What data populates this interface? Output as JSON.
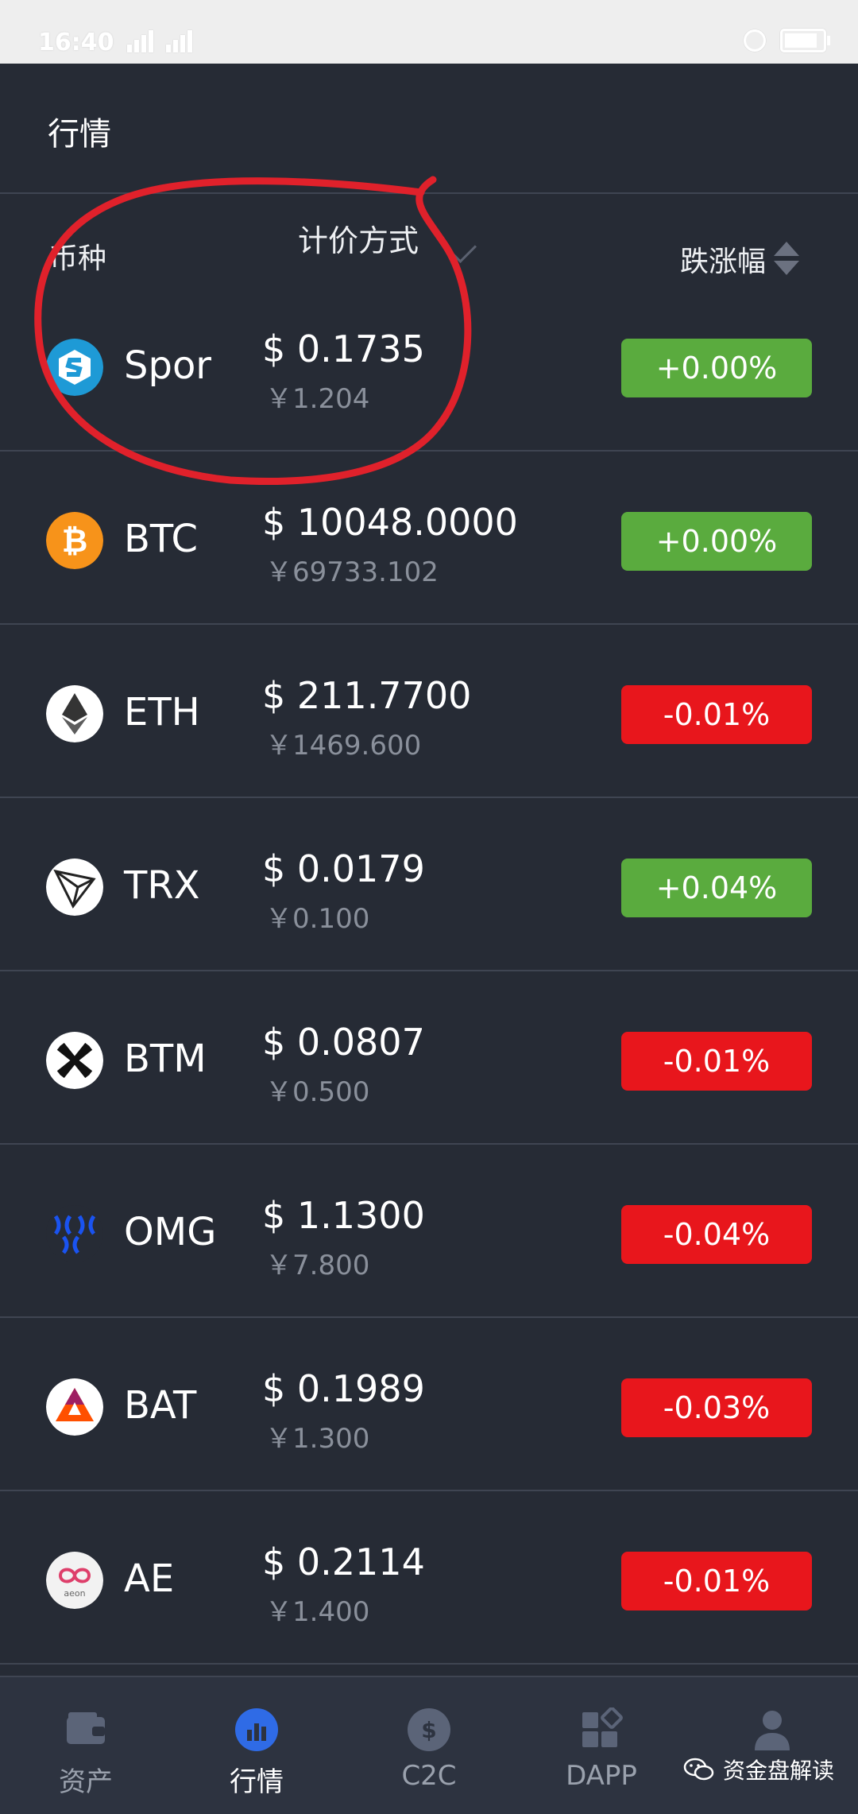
{
  "status_bar": {
    "time": "16:40"
  },
  "header": {
    "title": "行情"
  },
  "columns": {
    "coin": "币种",
    "pricing_method": "计价方式",
    "change": "跌涨幅"
  },
  "colors": {
    "up": "#5aab3e",
    "down": "#e8161c",
    "background": "#262b35",
    "annotation": "#e0212b"
  },
  "rows": [
    {
      "symbol": "Spor",
      "icon": "spor-icon",
      "price_usd": "$ 0.1735",
      "price_cny": "￥1.204",
      "change": "+0.00%",
      "trend": "up"
    },
    {
      "symbol": "BTC",
      "icon": "bitcoin-icon",
      "price_usd": "$ 10048.0000",
      "price_cny": "￥69733.102",
      "change": "+0.00%",
      "trend": "up"
    },
    {
      "symbol": "ETH",
      "icon": "ethereum-icon",
      "price_usd": "$ 211.7700",
      "price_cny": "￥1469.600",
      "change": "-0.01%",
      "trend": "down"
    },
    {
      "symbol": "TRX",
      "icon": "tron-icon",
      "price_usd": "$ 0.0179",
      "price_cny": "￥0.100",
      "change": "+0.04%",
      "trend": "up"
    },
    {
      "symbol": "BTM",
      "icon": "bytom-icon",
      "price_usd": "$ 0.0807",
      "price_cny": "￥0.500",
      "change": "-0.01%",
      "trend": "down"
    },
    {
      "symbol": "OMG",
      "icon": "omisego-icon",
      "price_usd": "$ 1.1300",
      "price_cny": "￥7.800",
      "change": "-0.04%",
      "trend": "down"
    },
    {
      "symbol": "BAT",
      "icon": "bat-icon",
      "price_usd": "$ 0.1989",
      "price_cny": "￥1.300",
      "change": "-0.03%",
      "trend": "down"
    },
    {
      "symbol": "AE",
      "icon": "aeternity-icon",
      "price_usd": "$ 0.2114",
      "price_cny": "￥1.400",
      "change": "-0.01%",
      "trend": "down"
    }
  ],
  "bottom_nav": [
    {
      "label": "资产",
      "icon": "wallet-icon",
      "active": false
    },
    {
      "label": "行情",
      "icon": "market-chart-icon",
      "active": true
    },
    {
      "label": "C2C",
      "icon": "dollar-coin-icon",
      "active": false
    },
    {
      "label": "DAPP",
      "icon": "apps-grid-icon",
      "active": false
    },
    {
      "label": "",
      "icon": "user-icon",
      "active": false
    }
  ],
  "watermark": {
    "text": "资金盘解读",
    "icon": "wechat-icon"
  }
}
